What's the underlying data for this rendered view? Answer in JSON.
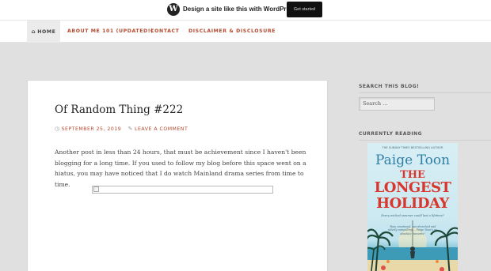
{
  "wpbar": {
    "logo_glyph": "W",
    "text": "Design a site like this with WordPress.com",
    "button_label": "Get started"
  },
  "nav": {
    "home_icon": "⌂",
    "home": "HOME",
    "items": [
      "ABOUT ME 101 (UPDATED!)",
      "CONTACT",
      "DISCLAIMER & DISCLOSURE"
    ]
  },
  "post": {
    "title": "Of Random Thing #222",
    "date_icon": "◷",
    "date": "SEPTEMBER 25, 2019",
    "comment_icon": "✎",
    "comment_link": "LEAVE A COMMENT",
    "body": "Another post in less than 24 hours, that must be achievement since I haven't been blogging for a long time. If you used to follow my blog before this space went on a hiatus, you may have noticed that I do watch Mainland drama series from time to time."
  },
  "sidebar": {
    "search_heading": "SEARCH THIS BLOG!",
    "search_placeholder": "Search …",
    "reading_heading": "CURRENTLY READING"
  },
  "book": {
    "top_line": "THE SUNDAY TIMES BESTSELLING AUTHOR",
    "author": "Paige Toon",
    "title_line1": "THE",
    "title_line2": "LONGEST",
    "title_line3": "HOLIDAY",
    "tagline": "Every wicked summer could last a lifetime?",
    "quote": "'Raw, emotional, sun-drenched and utterly compelling ... Paige Toon's an absolute favourite'"
  },
  "colors": {
    "accent": "#b5492f",
    "background": "#e0e0e0",
    "book_title": "#d9372d",
    "book_author": "#2f7fa6"
  }
}
